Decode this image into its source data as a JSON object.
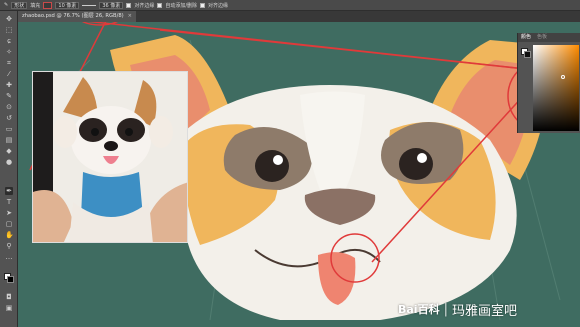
{
  "options_bar": {
    "tool_name": "形状",
    "mode_label": "填充",
    "stroke_value": "10 像素",
    "size_label": "36 像素",
    "align_label": "对齐边缘",
    "auto_label": "自动添加/删除",
    "align_edges": "对齐边缘"
  },
  "document_tab": {
    "title": "zhaobao.psd @ 76.7% (图层 26, RGB/8)",
    "close": "×"
  },
  "color_panel": {
    "tab_active": "颜色",
    "tab_inactive": "色板"
  },
  "watermark": {
    "logo": "Bai",
    "logo_cn": "百科",
    "separator": "|",
    "text": "玛雅画室吧"
  },
  "colors": {
    "canvas_bg": "#3f6c61",
    "fur_orange": "#f0b65c",
    "fur_white": "#f3f0ea",
    "ear_pink": "#e98e6d",
    "annotation_red": "#e03a3a"
  },
  "icons": [
    "brush-tool-icon",
    "move-tool-icon",
    "marquee-tool-icon",
    "lasso-tool-icon",
    "crop-tool-icon",
    "eyedropper-tool-icon",
    "healing-tool-icon",
    "brush-tool-icon",
    "clone-tool-icon",
    "history-tool-icon",
    "eraser-tool-icon",
    "gradient-tool-icon",
    "blur-tool-icon",
    "dodge-tool-icon",
    "pen-tool-icon",
    "type-tool-icon",
    "path-select-tool-icon",
    "shape-tool-icon",
    "hand-tool-icon",
    "zoom-tool-icon"
  ]
}
